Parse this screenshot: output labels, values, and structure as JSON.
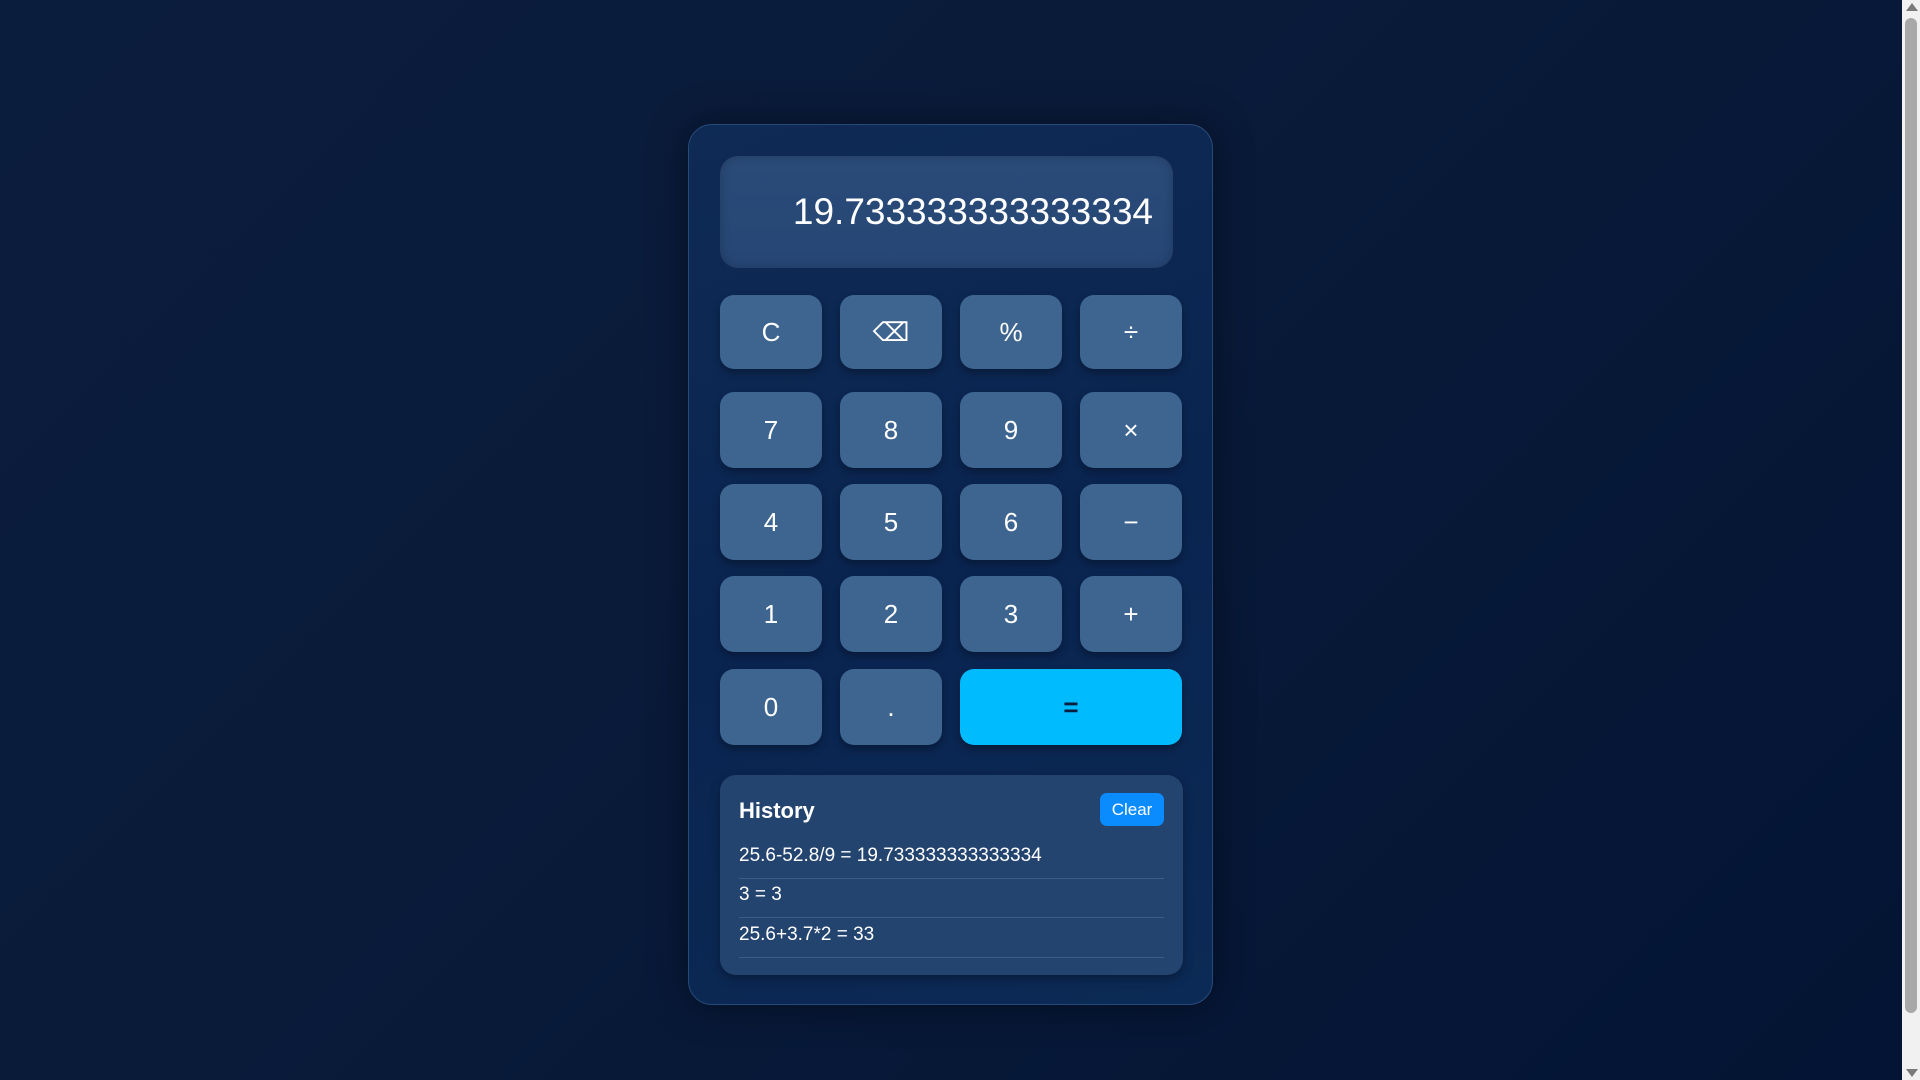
{
  "display": {
    "value": "19.733333333333334"
  },
  "keys": {
    "clear": "C",
    "backspace": "⌫",
    "percent": "%",
    "divide": "÷",
    "seven": "7",
    "eight": "8",
    "nine": "9",
    "multiply": "×",
    "four": "4",
    "five": "5",
    "six": "6",
    "minus": "−",
    "one": "1",
    "two": "2",
    "three": "3",
    "plus": "+",
    "zero": "0",
    "decimal": ".",
    "equals": "="
  },
  "history": {
    "title": "History",
    "clear_label": "Clear",
    "items": [
      "25.6-52.8/9 = 19.733333333333334",
      "3 = 3",
      "25.6+3.7*2 = 33"
    ]
  },
  "colors": {
    "background": "#0b1d3d",
    "panel": "#0e2b55",
    "key": "#3d6590",
    "equals_key": "#00bcff",
    "clear_button": "#0a8cff"
  }
}
